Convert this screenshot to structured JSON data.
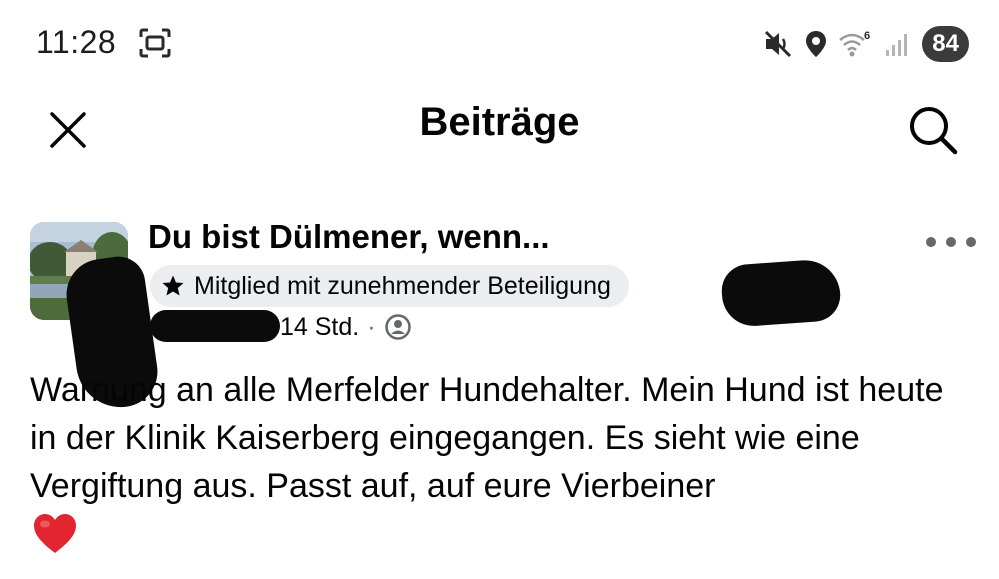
{
  "status_bar": {
    "time": "11:28",
    "battery": "84",
    "wifi_label": "6",
    "icons": [
      "screen-record-icon",
      "mute-icon",
      "location-icon",
      "wifi-icon",
      "signal-icon",
      "battery-icon"
    ]
  },
  "header": {
    "title": "Beiträge",
    "close_icon": "close-icon",
    "search_icon": "search-icon"
  },
  "post": {
    "group_name": "Du bist Dülmener, wenn...",
    "badge": {
      "icon": "star-icon",
      "label": "Mitglied mit zunehmender Beteiligung"
    },
    "time_ago": "14 Std.",
    "separator": "·",
    "audience_icon": "group-audience-icon",
    "body": "Warnung an alle Merfelder Hundehalter. Mein Hund ist heute in der Klinik Kaiserberg eingegangen. Es sieht wie eine Vergiftung aus. Passt auf, auf eure Vierbeiner",
    "emoji": "heart-icon"
  },
  "colors": {
    "text": "#050505",
    "secondary": "#65676b",
    "badge_bg": "#ebedf0",
    "heart": "#e2262f"
  }
}
